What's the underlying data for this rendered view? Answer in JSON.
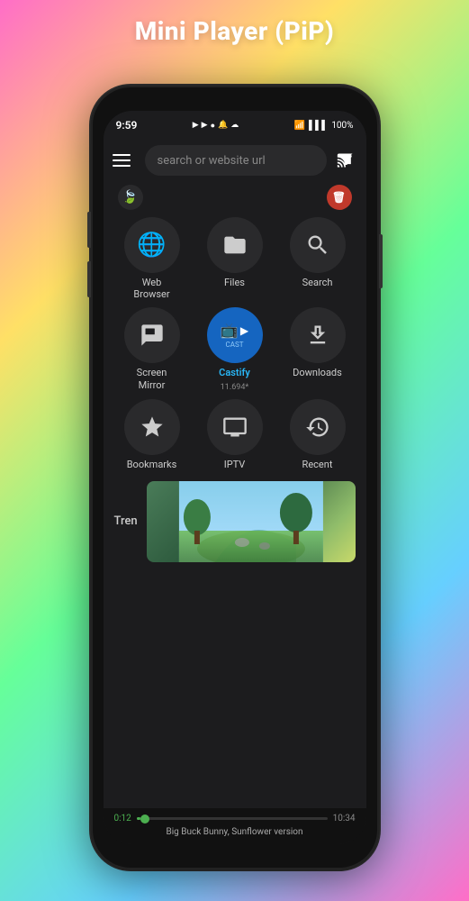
{
  "page": {
    "title": "Mini Player (PiP)"
  },
  "statusBar": {
    "time": "9:59",
    "battery": "100%",
    "signal": "📶",
    "wifi": "WiFi",
    "icons": [
      "▶",
      "☁"
    ]
  },
  "searchBar": {
    "placeholder": "search or website url"
  },
  "appGrid": [
    {
      "id": "web-browser",
      "label": "Web\nBrowser",
      "icon": "🌐",
      "sublabel": ""
    },
    {
      "id": "files",
      "label": "Files",
      "icon": "💾",
      "sublabel": ""
    },
    {
      "id": "search",
      "label": "Search",
      "icon": "🔍",
      "sublabel": ""
    },
    {
      "id": "screen-mirror",
      "label": "Screen\nMirror",
      "icon": "⊡",
      "sublabel": ""
    },
    {
      "id": "castify",
      "label": "Castify",
      "icon": "castify",
      "sublabel": "11.694*"
    },
    {
      "id": "downloads",
      "label": "Downloads",
      "icon": "⬇",
      "sublabel": ""
    },
    {
      "id": "bookmarks",
      "label": "Bookmarks",
      "icon": "★",
      "sublabel": ""
    },
    {
      "id": "iptv",
      "label": "IPTV",
      "icon": "📺",
      "sublabel": ""
    },
    {
      "id": "recent",
      "label": "Recent",
      "icon": "🕐",
      "sublabel": ""
    }
  ],
  "trending": {
    "label": "Tren"
  },
  "player": {
    "timeCurrentLabel": "0:12",
    "timeTotalLabel": "10:34",
    "nowPlaying": "Big Buck Bunny, Sunflower version",
    "progressPercent": 2
  },
  "buttons": {
    "hamburger": "menu",
    "cast": "cast"
  }
}
